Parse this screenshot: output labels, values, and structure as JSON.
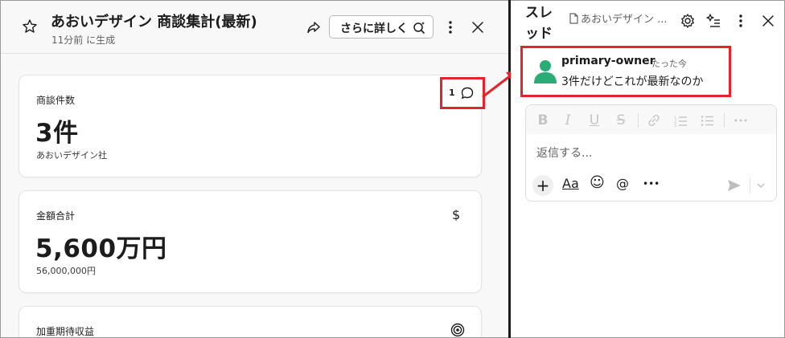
{
  "left_panel": {
    "title": "あおいデザイン 商談集計(最新)",
    "subtitle": "11分前 に生成",
    "more_button_label": "さらに詳しく",
    "icons": [
      "star-icon",
      "share-icon",
      "search-sparkle-icon",
      "kebab-icon",
      "close-icon"
    ],
    "cards": [
      {
        "label": "商談件数",
        "value": "3件",
        "sub": "あおいデザイン社",
        "comment_count": "1",
        "icon": "comment-icon"
      },
      {
        "label": "金額合計",
        "value": "5,600万円",
        "sub": "56,000,000円",
        "icon_glyph": "$"
      },
      {
        "label": "加重期待収益",
        "icon": "target-icon"
      }
    ]
  },
  "thread": {
    "title": "スレッド",
    "file_name": "あおいデザイン ...",
    "icons": [
      "file-icon",
      "gear-icon",
      "ai-list-icon",
      "kebab-icon",
      "close-icon"
    ],
    "message": {
      "author": "primary-owner",
      "time": "たった今",
      "text": "3件だけどこれが最新なのか"
    },
    "composer": {
      "placeholder": "返信する...",
      "toolbar": [
        "B",
        "I",
        "U",
        "S",
        "link",
        "ordered-list",
        "bullet-list",
        "more"
      ],
      "controls": {
        "plus": "+",
        "format": "Aa",
        "emoji": "☺",
        "mention": "@",
        "more": "•••"
      }
    }
  },
  "colors": {
    "highlight": "#e3242b",
    "avatar": "#2bac76",
    "divider": "#1d1c1d"
  }
}
